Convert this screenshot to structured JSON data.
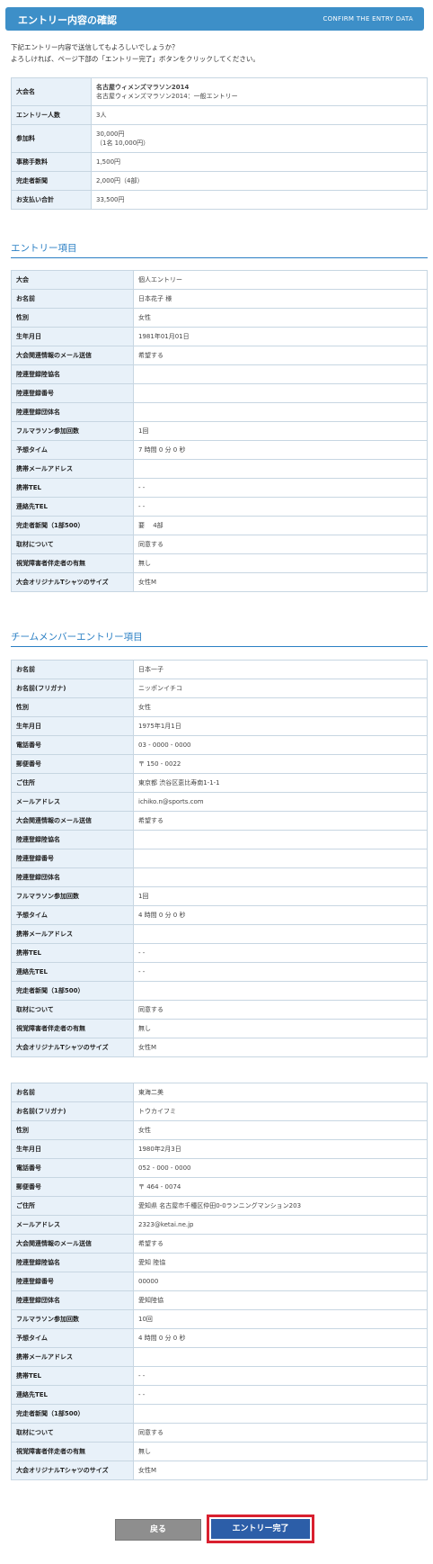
{
  "header": {
    "title": "エントリー内容の確認",
    "subtitle": "CONFIRM THE ENTRY DATA"
  },
  "intro": {
    "line1": "下記エントリー内容で送信してもよろしいでしょうか？",
    "line2": "よろしければ、ページ下部の「エントリー完了」ボタンをクリックしてください。"
  },
  "summary": [
    {
      "label": "大会名",
      "value": "名古屋ウィメンズマラソン2014",
      "value2": "名古屋ウィメンズマラソン2014：一般エントリー"
    },
    {
      "label": "エントリー人数",
      "value": "3人"
    },
    {
      "label": "参加料",
      "value": "30,000円",
      "value2": "（1名 10,000円）"
    },
    {
      "label": "事務手数料",
      "value": "1,500円"
    },
    {
      "label": "完走者新聞",
      "value": "2,000円（4部）"
    },
    {
      "label": "お支払い合計",
      "value": "33,500円"
    }
  ],
  "entry_section": {
    "heading": "エントリー項目"
  },
  "entry": [
    {
      "label": "大会",
      "value": "個人エントリー"
    },
    {
      "label": "お名前",
      "value": "日本花子 様"
    },
    {
      "label": "性別",
      "value": "女性"
    },
    {
      "label": "生年月日",
      "value": "1981年01月01日"
    },
    {
      "label": "大会関連情報のメール送信",
      "value": "希望する"
    },
    {
      "label": "陸連登録陸協名",
      "value": ""
    },
    {
      "label": "陸連登録番号",
      "value": ""
    },
    {
      "label": "陸連登録団体名",
      "value": ""
    },
    {
      "label": "フルマラソン参加回数",
      "value": "1回"
    },
    {
      "label": "予想タイム",
      "value": "7 時間 0 分 0 秒"
    },
    {
      "label": "携帯メールアドレス",
      "value": ""
    },
    {
      "label": "携帯TEL",
      "value": "- -"
    },
    {
      "label": "連絡先TEL",
      "value": "- -"
    },
    {
      "label": "完走者新聞（1部500）",
      "value": "要　 4部"
    },
    {
      "label": "取材について",
      "value": "同意する"
    },
    {
      "label": "視覚障害者伴走者の有無",
      "value": "無し"
    },
    {
      "label": "大会オリジナルTシャツのサイズ",
      "value": "女性M"
    }
  ],
  "team_section": {
    "heading": "チームメンバーエントリー項目"
  },
  "members": [
    [
      {
        "label": "お名前",
        "value": "日本一子"
      },
      {
        "label": "お名前(フリガナ)",
        "value": "ニッポンイチコ"
      },
      {
        "label": "性別",
        "value": "女性"
      },
      {
        "label": "生年月日",
        "value": "1975年1月1日"
      },
      {
        "label": "電話番号",
        "value": "03 - 0000 - 0000"
      },
      {
        "label": "郵便番号",
        "value": "〒 150 - 0022"
      },
      {
        "label": "ご住所",
        "value": "東京都 渋谷区恵比寿南1-1-1"
      },
      {
        "label": "メールアドレス",
        "value": "ichiko.n@sports.com"
      },
      {
        "label": "大会関連情報のメール送信",
        "value": "希望する"
      },
      {
        "label": "陸連登録陸協名",
        "value": ""
      },
      {
        "label": "陸連登録番号",
        "value": ""
      },
      {
        "label": "陸連登録団体名",
        "value": ""
      },
      {
        "label": "フルマラソン参加回数",
        "value": "1回"
      },
      {
        "label": "予想タイム",
        "value": "4 時間 0 分 0 秒"
      },
      {
        "label": "携帯メールアドレス",
        "value": ""
      },
      {
        "label": "携帯TEL",
        "value": "- -"
      },
      {
        "label": "連絡先TEL",
        "value": "- -"
      },
      {
        "label": "完走者新聞（1部500）",
        "value": ""
      },
      {
        "label": "取材について",
        "value": "同意する"
      },
      {
        "label": "視覚障害者伴走者の有無",
        "value": "無し"
      },
      {
        "label": "大会オリジナルTシャツのサイズ",
        "value": "女性M"
      }
    ],
    [
      {
        "label": "お名前",
        "value": "東海二美"
      },
      {
        "label": "お名前(フリガナ)",
        "value": "トウカイフミ"
      },
      {
        "label": "性別",
        "value": "女性"
      },
      {
        "label": "生年月日",
        "value": "1980年2月3日"
      },
      {
        "label": "電話番号",
        "value": "052 - 000 - 0000"
      },
      {
        "label": "郵便番号",
        "value": "〒 464 - 0074"
      },
      {
        "label": "ご住所",
        "value": "愛知県 名古屋市千種区仲田0-0ランニングマンション203"
      },
      {
        "label": "メールアドレス",
        "value": "2323@ketai.ne.jp"
      },
      {
        "label": "大会関連情報のメール送信",
        "value": "希望する"
      },
      {
        "label": "陸連登録陸協名",
        "value": "愛知 陸協"
      },
      {
        "label": "陸連登録番号",
        "value": "00000"
      },
      {
        "label": "陸連登録団体名",
        "value": "愛知陸協"
      },
      {
        "label": "フルマラソン参加回数",
        "value": "10回"
      },
      {
        "label": "予想タイム",
        "value": "4 時間 0 分 0 秒"
      },
      {
        "label": "携帯メールアドレス",
        "value": ""
      },
      {
        "label": "携帯TEL",
        "value": "- -"
      },
      {
        "label": "連絡先TEL",
        "value": "- -"
      },
      {
        "label": "完走者新聞（1部500）",
        "value": ""
      },
      {
        "label": "取材について",
        "value": "同意する"
      },
      {
        "label": "視覚障害者伴走者の有無",
        "value": "無し"
      },
      {
        "label": "大会オリジナルTシャツのサイズ",
        "value": "女性M"
      }
    ]
  ],
  "buttons": {
    "back": "戻る",
    "complete": "エントリー完了"
  }
}
